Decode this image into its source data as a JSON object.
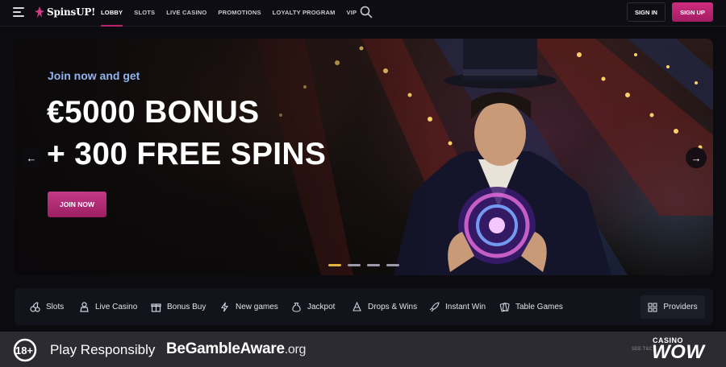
{
  "header": {
    "logo_text": "SpinsUP!",
    "nav": [
      "LOBBY",
      "SLOTS",
      "LIVE CASINO",
      "PROMOTIONS",
      "LOYALTY PROGRAM",
      "VIP"
    ],
    "signin_label": "SIGN IN",
    "signup_label": "SIGN UP",
    "accent_color": "#c0236e"
  },
  "hero": {
    "kicker": "Join now and get",
    "title_line1": "€5000 BONUS",
    "title_line2": "+ 300 FREE SPINS",
    "cta_label": "JOIN NOW",
    "prev_icon": "←",
    "next_icon": "→",
    "slide_count": 4,
    "active_slide": 1
  },
  "categories": {
    "items": [
      {
        "label": "Slots",
        "icon": "cherries-icon"
      },
      {
        "label": "Live Casino",
        "icon": "dealer-icon"
      },
      {
        "label": "Bonus Buy",
        "icon": "gift-icon"
      },
      {
        "label": "New games",
        "icon": "lightning-icon"
      },
      {
        "label": "Jackpot",
        "icon": "money-bag-icon"
      },
      {
        "label": "Drops & Wins",
        "icon": "drops-icon"
      },
      {
        "label": "Instant Win",
        "icon": "rocket-icon"
      },
      {
        "label": "Table Games",
        "icon": "cards-icon"
      }
    ],
    "providers_label": "Providers"
  },
  "footer": {
    "age_badge": "18+",
    "play_responsibly": "Play Responsibly",
    "bga_main": "BeGambleAware",
    "bga_suffix": ".org",
    "see_terms": "SEE T&C",
    "watermark_top": "CASINO",
    "watermark_main": "WOW"
  }
}
